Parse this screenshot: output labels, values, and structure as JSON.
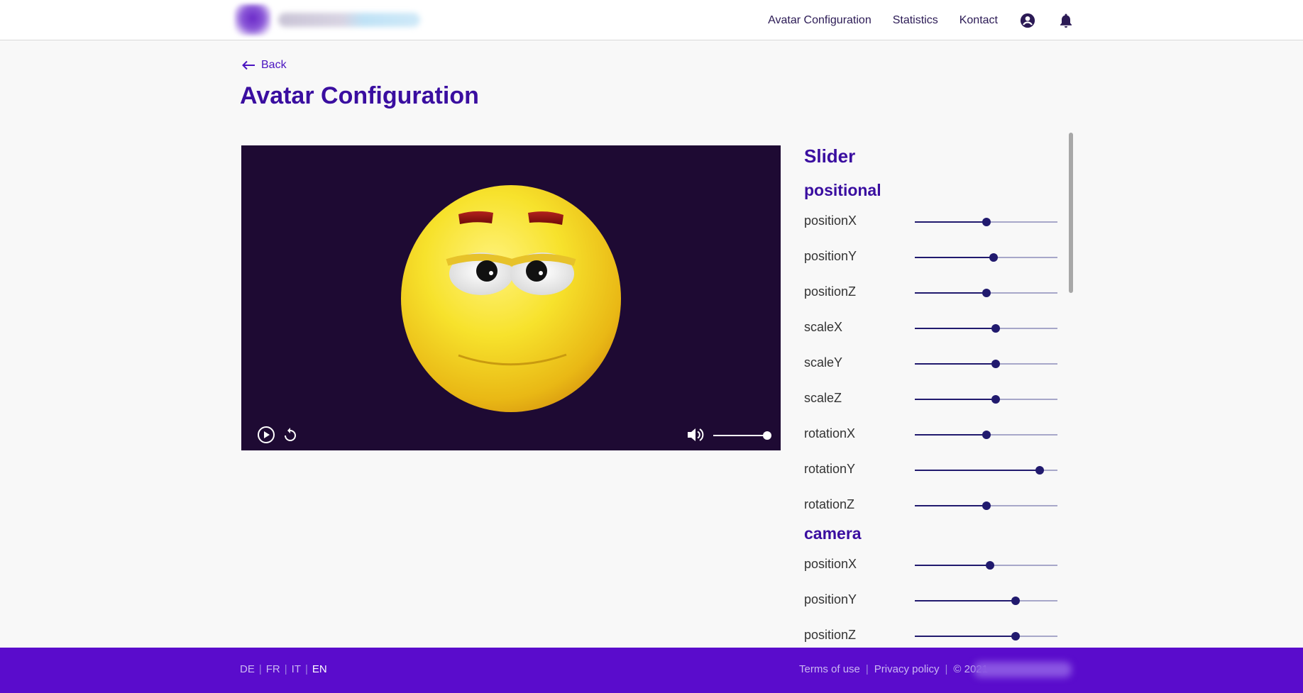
{
  "header": {
    "nav": [
      "Avatar Configuration",
      "Statistics",
      "Kontact"
    ],
    "icons": [
      "account-circle-icon",
      "bell-icon"
    ]
  },
  "back_label": "Back",
  "page_title": "Avatar Configuration",
  "player": {
    "icons": [
      "play-icon",
      "replay-icon",
      "volume-icon"
    ],
    "volume_level": 1.0
  },
  "panel": {
    "title": "Slider",
    "sections": [
      {
        "title": "positional",
        "sliders": [
          {
            "label": "positionX",
            "value": 0.5
          },
          {
            "label": "positionY",
            "value": 0.55
          },
          {
            "label": "positionZ",
            "value": 0.5
          },
          {
            "label": "scaleX",
            "value": 0.565
          },
          {
            "label": "scaleY",
            "value": 0.565
          },
          {
            "label": "scaleZ",
            "value": 0.565
          },
          {
            "label": "rotationX",
            "value": 0.5
          },
          {
            "label": "rotationY",
            "value": 0.875
          },
          {
            "label": "rotationZ",
            "value": 0.5
          }
        ]
      },
      {
        "title": "camera",
        "sliders": [
          {
            "label": "positionX",
            "value": 0.525
          },
          {
            "label": "positionY",
            "value": 0.705
          },
          {
            "label": "positionZ",
            "value": 0.705
          }
        ]
      }
    ]
  },
  "footer": {
    "languages": [
      {
        "code": "DE",
        "active": false
      },
      {
        "code": "FR",
        "active": false
      },
      {
        "code": "IT",
        "active": false
      },
      {
        "code": "EN",
        "active": true
      }
    ],
    "terms": "Terms of use",
    "privacy": "Privacy policy",
    "copyright": "© 2021"
  },
  "colors": {
    "accent": "#3a0ea0",
    "footer_bg": "#5a0ccc",
    "player_bg": "#1e0a33",
    "slider": "#211a6e"
  }
}
